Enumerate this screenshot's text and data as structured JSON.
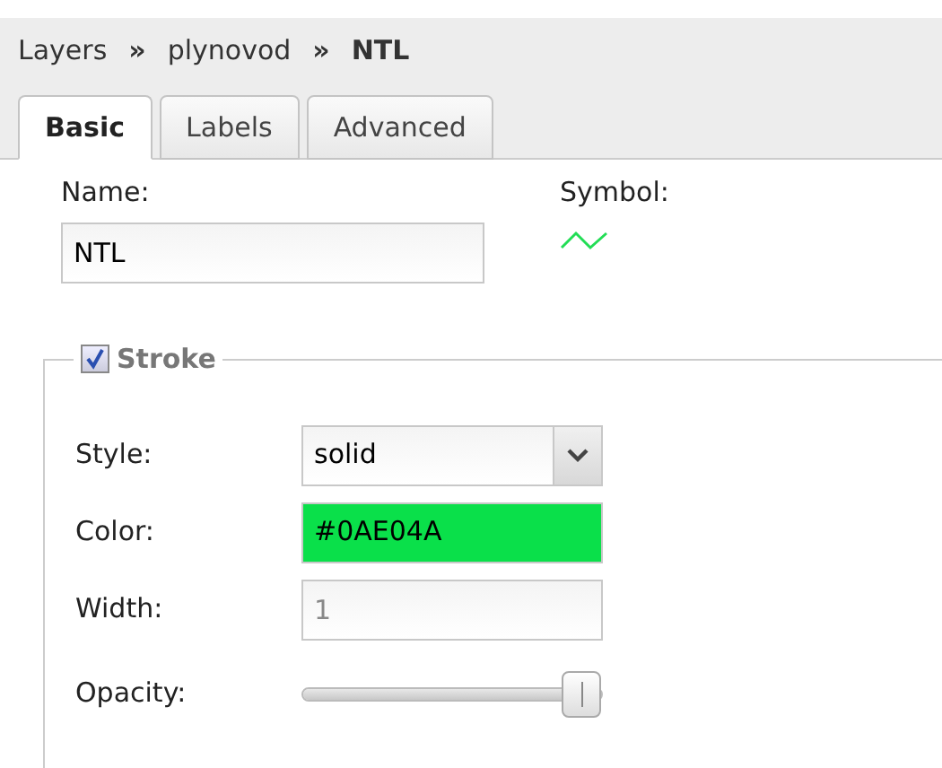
{
  "breadcrumb": [
    {
      "label": "Layers",
      "current": false
    },
    {
      "label": "plynovod",
      "current": false
    },
    {
      "label": "NTL",
      "current": true
    }
  ],
  "breadcrumb_separator": "»",
  "tabs": [
    {
      "label": "Basic",
      "selected": true
    },
    {
      "label": "Labels",
      "selected": false
    },
    {
      "label": "Advanced",
      "selected": false
    }
  ],
  "name": {
    "label": "Name:",
    "value": "NTL"
  },
  "symbol": {
    "label": "Symbol:",
    "color": "#22dd55"
  },
  "stroke": {
    "legend": "Stroke",
    "checked": true,
    "fields": [
      {
        "kind": "select",
        "label": "Style:",
        "value": "solid"
      },
      {
        "kind": "color",
        "label": "Color:",
        "value": "#0AE04A",
        "color": "#0ae04a"
      },
      {
        "kind": "text",
        "label": "Width:",
        "placeholder": "1"
      },
      {
        "kind": "slider",
        "label": "Opacity:",
        "level": 1
      }
    ]
  }
}
